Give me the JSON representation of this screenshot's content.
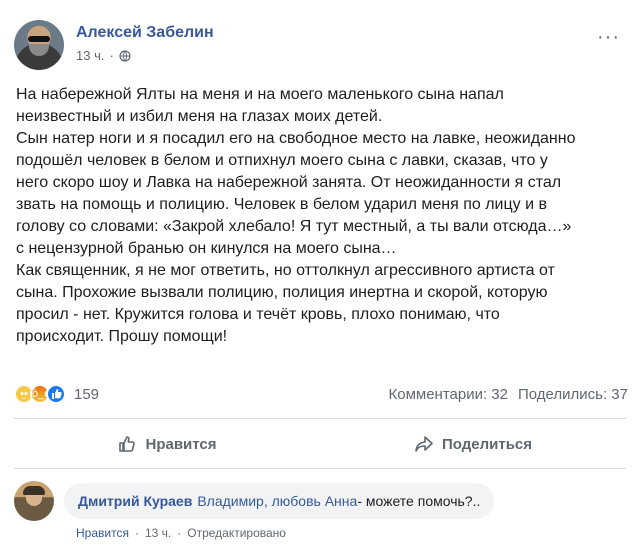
{
  "post": {
    "author": "Алексей Забелин",
    "time": "13 ч.",
    "separator": "·",
    "more": "···",
    "body": [
      "На набережной Ялты на меня и на моего маленького сына напал",
      "неизвестный и избил меня на глазах моих детей.",
      "Сын натер ноги и я посадил его на свободное место на лавке, неожиданно",
      "подошёл человек в белом и отпихнул моего сына с лавки, сказав, что у",
      "него скоро шоу и Лавка на набережной занята. От неожиданности я стал",
      "звать на помощь и полицию. Человек в белом ударил меня по лицу и в",
      "голову со словами: «Закрой хлебало! Я тут местный, а ты вали отсюда…»",
      "с нецензурной бранью он кинулся на моего сына…",
      "Как священник, я не мог ответить, но оттолкнул агрессивного артиста от",
      "сына. Прохожие вызвали полицию, полиция инертна и скорой, которую",
      "просил - нет. Кружится голова и течёт кровь, плохо понимаю, что",
      "происходит. Прошу помощи!"
    ]
  },
  "stats": {
    "reactions_count": "159",
    "comments": "Комментарии: 32",
    "shares": "Поделились: 37"
  },
  "actions": {
    "like": "Нравится",
    "share": "Поделиться"
  },
  "comment": {
    "author": "Дмитрий Кураев",
    "mention": "Владимир, любовь Анна",
    "text": "- можете помочь?..",
    "like": "Нравится",
    "sep1": "·",
    "time": "13 ч.",
    "sep2": "·",
    "edited": "Отредактировано"
  },
  "colors": {
    "link": "#385898",
    "like_blue": "#1877f2",
    "muted": "#606770"
  },
  "icons": [
    "globe-icon",
    "more-icon",
    "sad-reaction-icon",
    "angry-reaction-icon",
    "like-reaction-icon",
    "thumbs-up-icon",
    "share-arrow-icon"
  ]
}
